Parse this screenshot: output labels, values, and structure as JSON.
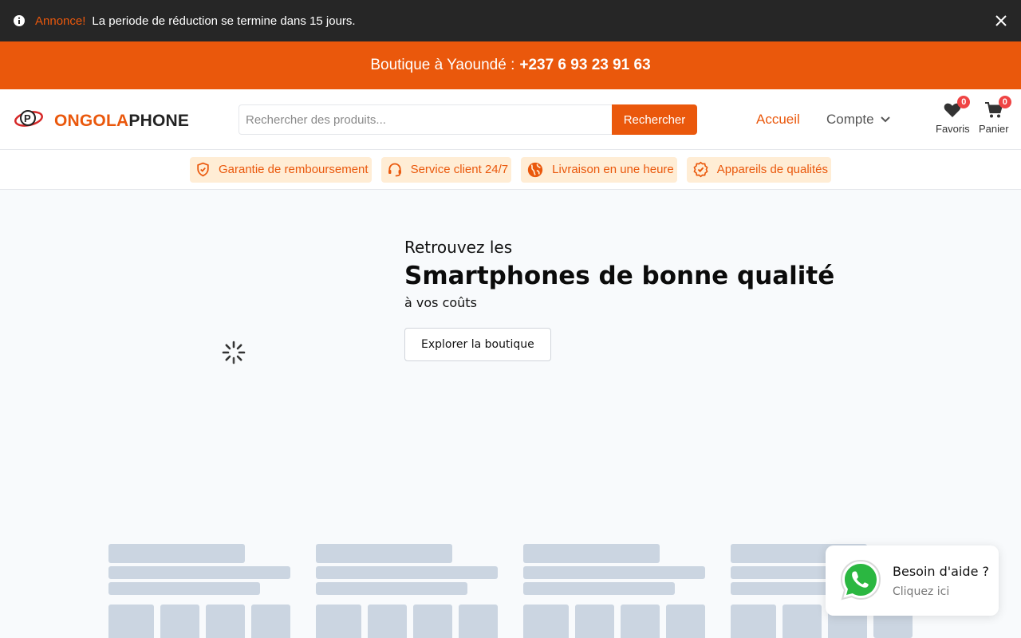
{
  "announcement": {
    "label": "Annonce!",
    "message": "La periode de réduction se termine dans 15 jours."
  },
  "store_bar": {
    "text": "Boutique à Yaoundé :",
    "phone": "+237 6 93 23 91 63"
  },
  "header": {
    "brand_part1": "ONGOLA",
    "brand_part2": "PHONE",
    "search_placeholder": "Rechercher des produits...",
    "search_button": "Rechercher",
    "nav_home": "Accueil",
    "nav_account": "Compte",
    "favorites_label": "Favoris",
    "favorites_count": "0",
    "cart_label": "Panier",
    "cart_count": "0"
  },
  "features": [
    {
      "label": "Garantie de remboursement",
      "icon": "shield-check-icon"
    },
    {
      "label": "Service client 24/7",
      "icon": "headset-icon"
    },
    {
      "label": "Livraison en une heure",
      "icon": "globe-icon"
    },
    {
      "label": "Appareils de qualités",
      "icon": "badge-check-icon"
    }
  ],
  "hero": {
    "pre": "Retrouvez les",
    "title": "Smartphones de bonne qualité",
    "post": "à vos coûts",
    "cta": "Explorer la boutique"
  },
  "whatsapp": {
    "title": "Besoin d'aide ?",
    "subtitle": "Cliquez ici"
  },
  "colors": {
    "accent": "#ea580c",
    "dark": "#262626",
    "skeleton": "#cbd5e1"
  }
}
